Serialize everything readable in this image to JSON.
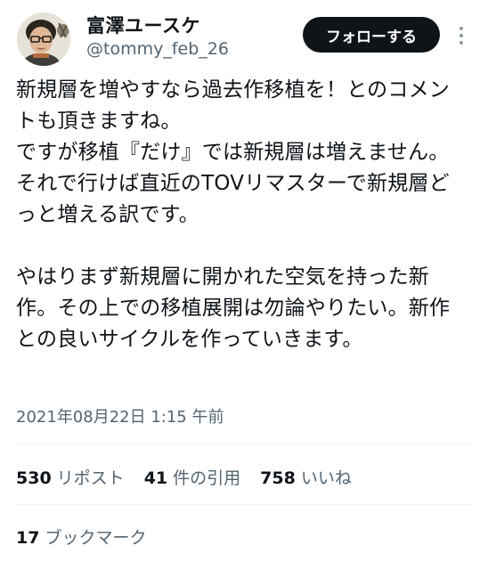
{
  "author": {
    "display_name": "富澤ユースケ",
    "handle": "@tommy_feb_26",
    "avatar_icon": "user-avatar"
  },
  "header": {
    "follow_label": "フォローする",
    "more_icon": "more-dots-icon"
  },
  "tweet": {
    "text": "新規層を増やすなら過去作移植を！とのコメントも頂きますね。\nですが移植『だけ』では新規層は増えません。それで行けば直近のTOVリマスターで新規層どっと増える訳です。\n\nやはりまず新規層に開かれた空気を持った新作。その上での移植展開は勿論やりたい。新作との良いサイクルを作っていきます。",
    "timestamp": "2021年08月22日 1:15 午前"
  },
  "stats": {
    "reposts_count": "530",
    "reposts_label": "リポスト",
    "quotes_count": "41",
    "quotes_label": "件の引用",
    "likes_count": "758",
    "likes_label": "いいね",
    "bookmarks_count": "17",
    "bookmarks_label": "ブックマーク"
  },
  "colors": {
    "text_primary": "#0f1419",
    "text_secondary": "#536471",
    "button_bg": "#0f1419",
    "divider": "#eff3f4"
  }
}
